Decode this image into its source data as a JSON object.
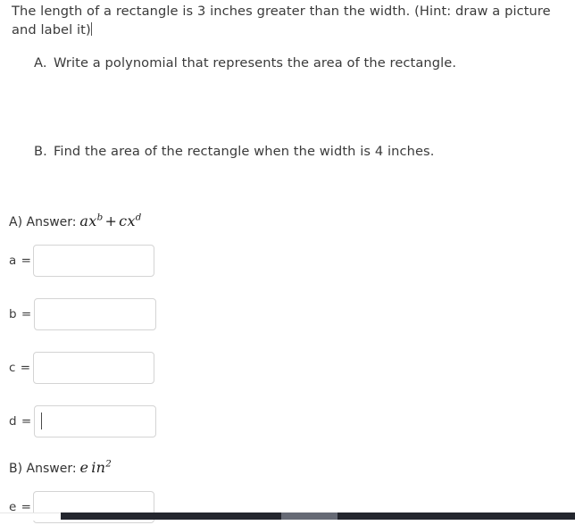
{
  "question": {
    "prompt_line_1": "The length of a rectangle is 3 inches greater than the width. (Hint: draw a picture",
    "prompt_line_2": "and label it)",
    "sub_questions": [
      {
        "marker": "A.",
        "text": "Write a polynomial that represents the area of the rectangle."
      },
      {
        "marker": "B.",
        "text": "Find the area of the rectangle when the width is 4 inches."
      }
    ]
  },
  "answers": {
    "a": {
      "label": "A) Answer:",
      "expression_plain": "ax^b + cx^d",
      "term1_coeff": "a",
      "term1_base": "x",
      "term1_exp": "b",
      "operator": "+",
      "term2_coeff": "c",
      "term2_base": "x",
      "term2_exp": "d"
    },
    "b": {
      "label": "B) Answer:",
      "expression_plain": "e in^2",
      "variable": "e",
      "unit": "in",
      "unit_exp": "2"
    }
  },
  "fields": [
    {
      "name": "a",
      "label": "a =",
      "value": "",
      "focused": false
    },
    {
      "name": "b",
      "label": "b =",
      "value": "",
      "focused": false
    },
    {
      "name": "c",
      "label": "c =",
      "value": "",
      "focused": false
    },
    {
      "name": "d",
      "label": "d =",
      "value": "",
      "focused": true
    },
    {
      "name": "e",
      "label": "e =",
      "value": "",
      "focused": false
    }
  ],
  "colors": {
    "page_background": "#ffffff",
    "text": "#3a3a3a",
    "field_border": "#d4d4d4",
    "scrollbar_track": "#24262e",
    "scrollbar_thumb": "#666a75"
  }
}
